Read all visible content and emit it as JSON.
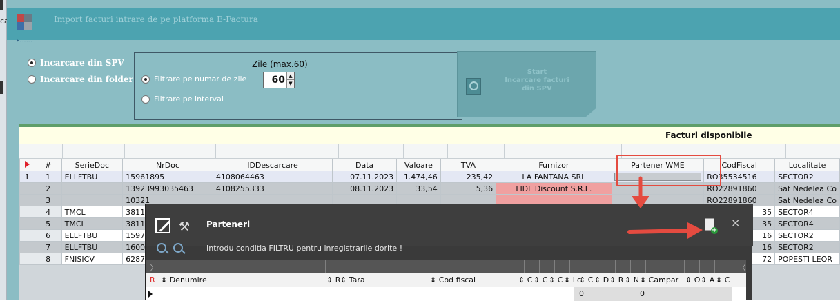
{
  "app": {
    "cut_label": "ca",
    "window_title": "Import facturi intrare de pe platforma E-Factura",
    "menu_dots": "▸∴∴∴"
  },
  "load": {
    "spv_label": "Incarcare din SPV",
    "folder_label": "Incarcare din folder",
    "zile_label": "Zile (max.60)",
    "days_value": "60",
    "filter_days_label": "Filtrare pe numar de zile",
    "filter_interval_label": "Filtrare pe interval",
    "start_label": "Start\nIncarcare facturi\ndin SPV"
  },
  "grid": {
    "title": "Facturi disponibile",
    "columns": [
      "#",
      "SerieDoc",
      "NrDoc",
      "IDDescarcare",
      "Data",
      "Valoare",
      "TVA",
      "Furnizor",
      "Partener WME",
      "CodFiscal",
      "Localitate"
    ],
    "rows": [
      {
        "no": "1",
        "serie": "ELLFTBU",
        "nrdoc": "15961895",
        "id": "4108064463",
        "data": "07.11.2023",
        "valoare": "1.474,46",
        "tva": "235,42",
        "furnizor": "LA FANTANA SRL",
        "partener": "",
        "codfiscal": "RO35534516",
        "localitate": "SECTOR2"
      },
      {
        "no": "2",
        "serie": "",
        "nrdoc": "13923993035463",
        "id": "4108255333",
        "data": "08.11.2023",
        "valoare": "33,54",
        "tva": "5,36",
        "furnizor": "LIDL Discount S.R.L.",
        "partener": "",
        "codfiscal": "RO22891860",
        "localitate": "Sat Nedelea Co"
      },
      {
        "no": "3",
        "serie": "",
        "nrdoc": "10321",
        "id": "",
        "data": "",
        "valoare": "",
        "tva": "",
        "furnizor": "",
        "partener": "",
        "codfiscal": "RO22891860",
        "localitate": "Sat Nedelea Co"
      },
      {
        "no": "4",
        "serie": "TMCL",
        "nrdoc": "3811",
        "id": "",
        "data": "",
        "valoare": "",
        "tva": "",
        "furnizor": "",
        "partener": "",
        "codfiscal": "35",
        "localitate": "SECTOR4"
      },
      {
        "no": "5",
        "serie": "TMCL",
        "nrdoc": "3811",
        "id": "",
        "data": "",
        "valoare": "",
        "tva": "",
        "furnizor": "",
        "partener": "",
        "codfiscal": "35",
        "localitate": "SECTOR4"
      },
      {
        "no": "6",
        "serie": "ELLFTBU",
        "nrdoc": "1597",
        "id": "",
        "data": "",
        "valoare": "",
        "tva": "",
        "furnizor": "",
        "partener": "",
        "codfiscal": "16",
        "localitate": "SECTOR2"
      },
      {
        "no": "7",
        "serie": "ELLFTBU",
        "nrdoc": "1600",
        "id": "",
        "data": "",
        "valoare": "",
        "tva": "",
        "furnizor": "",
        "partener": "",
        "codfiscal": "16",
        "localitate": "SECTOR2"
      },
      {
        "no": "8",
        "serie": "FNISICV",
        "nrdoc": "6287",
        "id": "",
        "data": "",
        "valoare": "",
        "tva": "",
        "furnizor": "",
        "partener": "",
        "codfiscal": "72",
        "localitate": "POPESTI LEOR"
      }
    ],
    "row_cursor": "I"
  },
  "dialog": {
    "title": "Parteneri",
    "hint": "Introdu conditia FILTRU pentru inregistrarile dorite !",
    "close": "×",
    "tools": "⚒",
    "scroll_left": "〉",
    "scroll_right": "〈",
    "columns": [
      "R",
      "⇕ Denumire",
      "⇕ R",
      "⇕ Tara",
      "⇕ Cod fiscal",
      "⇕ C",
      "⇕ C",
      "⇕ C",
      "⇕ Lc",
      "⇕ C",
      "⇕ D",
      "⇕ R",
      "⇕ N",
      "⇕ Campar",
      "⇕ O",
      "⇕ A",
      "⇕ C"
    ],
    "row_values": [
      "0",
      "0"
    ]
  },
  "colors": {
    "accent": "#4ca3b0",
    "window_bg": "#8bbdc4",
    "supplier_highlight": "#f0a0a0",
    "annotation_red": "#e44b40"
  }
}
